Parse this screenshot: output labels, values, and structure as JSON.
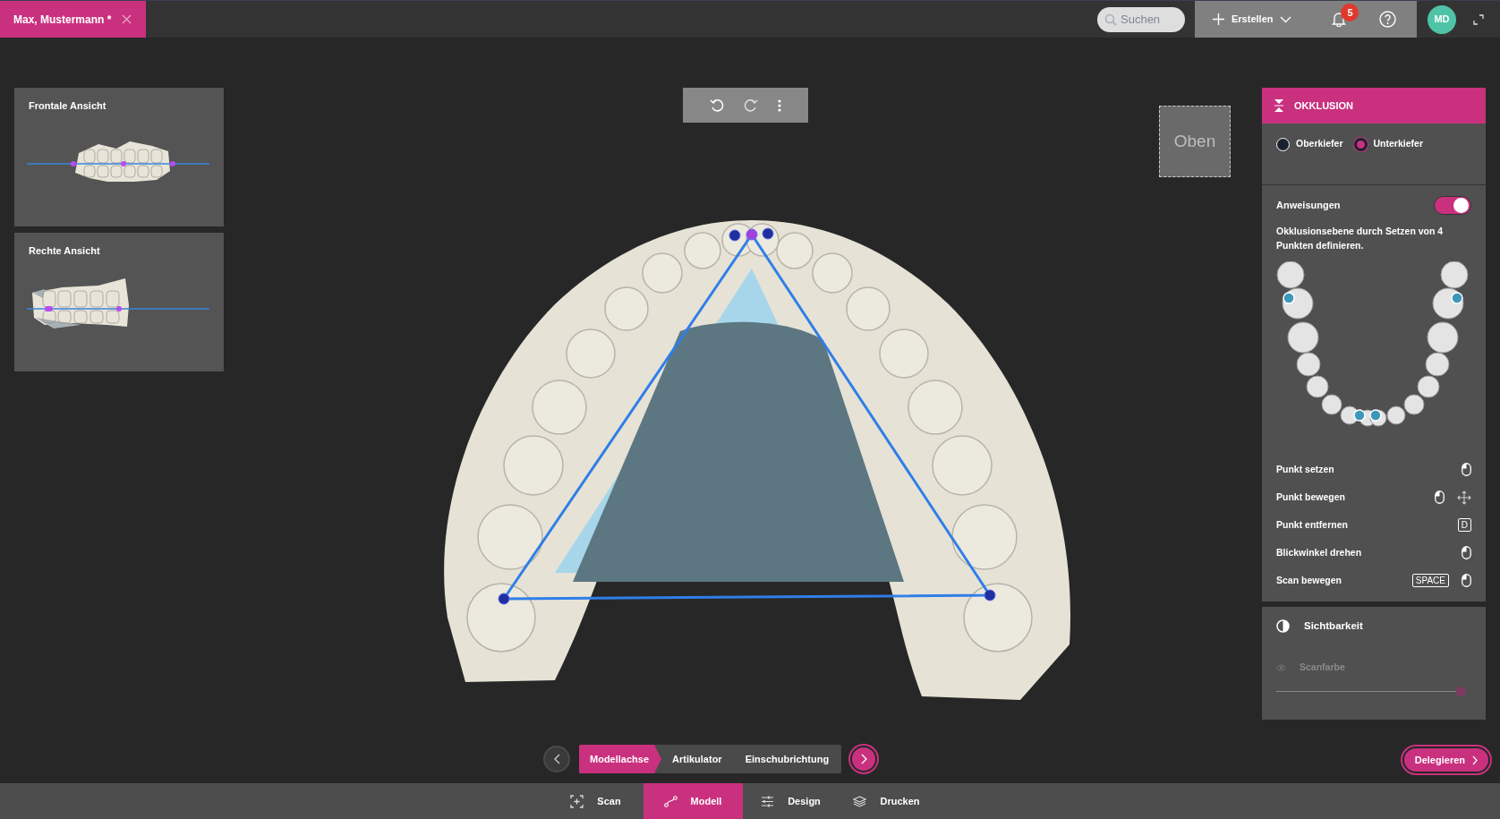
{
  "document_tab": {
    "title": "Max, Mustermann *"
  },
  "header": {
    "search": {
      "placeholder": "Suchen"
    },
    "create_button": "Erstellen",
    "notifications": {
      "count": "5"
    },
    "avatar": "MD"
  },
  "views": [
    {
      "title": "Frontale Ansicht",
      "kind": "front"
    },
    {
      "title": "Rechte Ansicht",
      "kind": "side"
    }
  ],
  "view_cube": {
    "label": "Oben"
  },
  "occlusion": {
    "title": "OKKLUSION",
    "jaws": [
      {
        "label": "Oberkiefer",
        "selected": false
      },
      {
        "label": "Unterkiefer",
        "selected": true
      }
    ],
    "instructions": {
      "label": "Anweisungen",
      "on": true,
      "text": "Okklusionsebene durch Setzen von 4 Punkten definieren."
    },
    "shortcuts": [
      {
        "label": "Punkt setzen",
        "inputs": [
          {
            "kind": "mouse"
          }
        ]
      },
      {
        "label": "Punkt bewegen",
        "inputs": [
          {
            "kind": "mouse"
          },
          {
            "kind": "move"
          }
        ]
      },
      {
        "label": "Punkt entfernen",
        "inputs": [
          {
            "kind": "key",
            "text": "D"
          }
        ]
      },
      {
        "label": "Blickwinkel drehen",
        "inputs": [
          {
            "kind": "mouse"
          }
        ]
      },
      {
        "label": "Scan bewegen",
        "inputs": [
          {
            "kind": "key",
            "text": "SPACE"
          },
          {
            "kind": "mouse"
          }
        ]
      }
    ]
  },
  "visibility": {
    "title": "Sichtbarkeit",
    "scan_color": {
      "label": "Scanfarbe",
      "level": 1
    }
  },
  "steps": [
    {
      "label": "Modellachse",
      "selected": true
    },
    {
      "label": "Artikulator",
      "selected": false
    },
    {
      "label": "Einschubrichtung",
      "selected": false
    }
  ],
  "delegate_button": "Delegieren",
  "nav_tabs": [
    {
      "label": "Scan",
      "kind": "scan",
      "selected": false
    },
    {
      "label": "Modell",
      "kind": "model",
      "selected": true
    },
    {
      "label": "Design",
      "kind": "design",
      "selected": false
    },
    {
      "label": "Drucken",
      "kind": "print",
      "selected": false
    }
  ]
}
